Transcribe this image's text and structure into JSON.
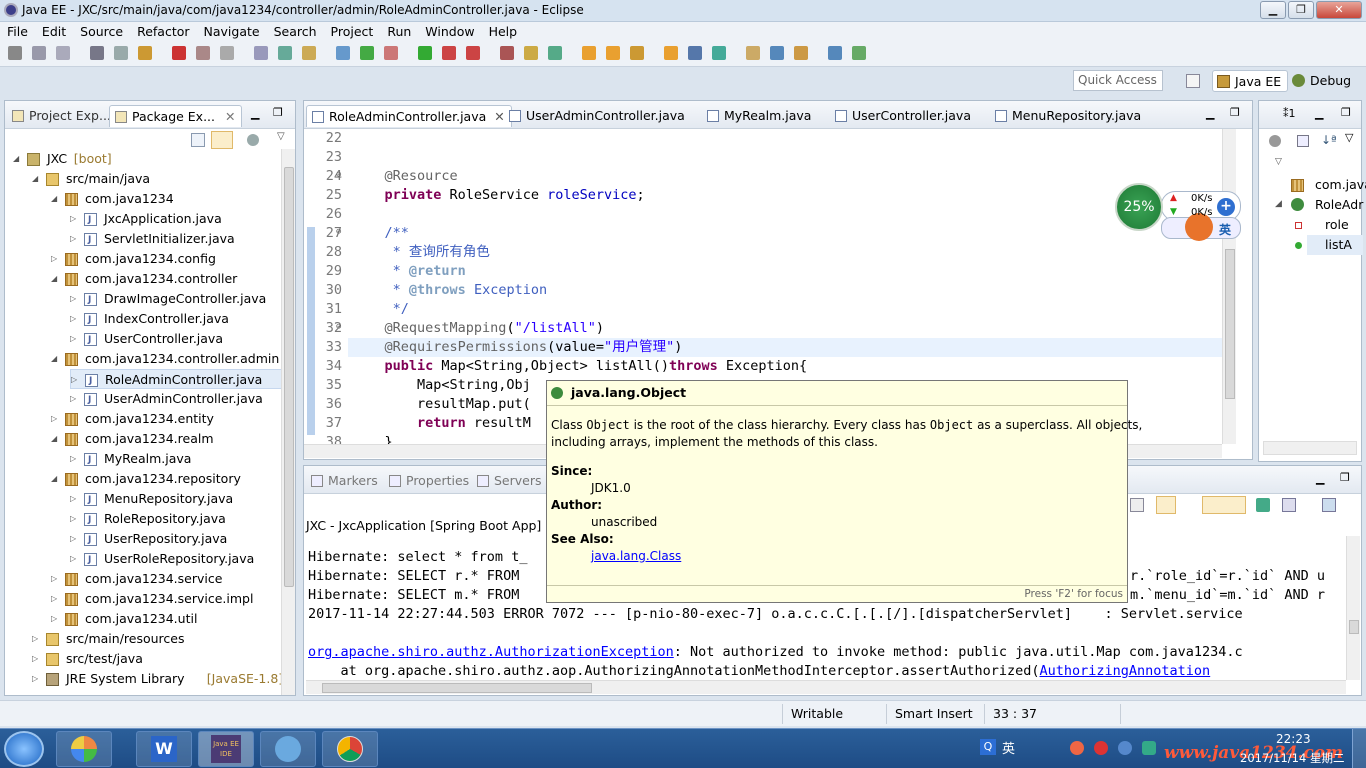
{
  "window": {
    "title": "Java EE - JXC/src/main/java/com/java1234/controller/admin/RoleAdminController.java - Eclipse"
  },
  "menu": [
    "File",
    "Edit",
    "Source",
    "Refactor",
    "Navigate",
    "Search",
    "Project",
    "Run",
    "Window",
    "Help"
  ],
  "quick_access": {
    "placeholder": "Quick Access"
  },
  "perspectives": [
    "Java EE",
    "Debug"
  ],
  "left_tabs": [
    "Project Exp...",
    "Package Ex..."
  ],
  "tree": [
    {
      "label": "JXC",
      "extra": "[boot]",
      "icon": "proj",
      "level": 0,
      "open": true
    },
    {
      "label": "src/main/java",
      "icon": "folder",
      "level": 1,
      "open": true
    },
    {
      "label": "com.java1234",
      "icon": "pkg",
      "level": 2,
      "open": true
    },
    {
      "label": "JxcApplication.java",
      "icon": "java",
      "level": 3,
      "open": false
    },
    {
      "label": "ServletInitializer.java",
      "icon": "java",
      "level": 3,
      "open": false
    },
    {
      "label": "com.java1234.config",
      "icon": "pkg",
      "level": 2,
      "open": false
    },
    {
      "label": "com.java1234.controller",
      "icon": "pkg",
      "level": 2,
      "open": true
    },
    {
      "label": "DrawImageController.java",
      "icon": "java",
      "level": 3,
      "open": false
    },
    {
      "label": "IndexController.java",
      "icon": "java",
      "level": 3,
      "open": false
    },
    {
      "label": "UserController.java",
      "icon": "java",
      "level": 3,
      "open": false
    },
    {
      "label": "com.java1234.controller.admin",
      "icon": "pkg",
      "level": 2,
      "open": true
    },
    {
      "label": "RoleAdminController.java",
      "icon": "java",
      "level": 3,
      "open": false,
      "selected": true
    },
    {
      "label": "UserAdminController.java",
      "icon": "java",
      "level": 3,
      "open": false
    },
    {
      "label": "com.java1234.entity",
      "icon": "pkg",
      "level": 2,
      "open": false
    },
    {
      "label": "com.java1234.realm",
      "icon": "pkg",
      "level": 2,
      "open": true
    },
    {
      "label": "MyRealm.java",
      "icon": "java",
      "level": 3,
      "open": false
    },
    {
      "label": "com.java1234.repository",
      "icon": "pkg",
      "level": 2,
      "open": true
    },
    {
      "label": "MenuRepository.java",
      "icon": "java",
      "level": 3,
      "open": false
    },
    {
      "label": "RoleRepository.java",
      "icon": "java",
      "level": 3,
      "open": false
    },
    {
      "label": "UserRepository.java",
      "icon": "java",
      "level": 3,
      "open": false
    },
    {
      "label": "UserRoleRepository.java",
      "icon": "java",
      "level": 3,
      "open": false
    },
    {
      "label": "com.java1234.service",
      "icon": "pkg",
      "level": 2,
      "open": false
    },
    {
      "label": "com.java1234.service.impl",
      "icon": "pkg",
      "level": 2,
      "open": false
    },
    {
      "label": "com.java1234.util",
      "icon": "pkg",
      "level": 2,
      "open": false
    },
    {
      "label": "src/main/resources",
      "icon": "folder",
      "level": 1,
      "open": false
    },
    {
      "label": "src/test/java",
      "icon": "folder",
      "level": 1,
      "open": false
    },
    {
      "label": "JRE System Library",
      "extra": "[JavaSE-1.8]",
      "icon": "lib",
      "level": 1,
      "open": false
    }
  ],
  "editor_tabs": [
    {
      "label": "RoleAdminController.java",
      "close": "✕"
    },
    {
      "label": "UserAdminController.java"
    },
    {
      "label": "MyRealm.java"
    },
    {
      "label": "UserController.java"
    },
    {
      "label": "MenuRepository.java"
    }
  ],
  "code": [
    {
      "n": "22",
      "t": [
        {
          "c": "",
          "s": ""
        }
      ]
    },
    {
      "n": "23",
      "t": [
        {
          "c": "",
          "s": ""
        }
      ]
    },
    {
      "n": "24",
      "t": [
        {
          "c": "an",
          "s": "    @Resource"
        }
      ]
    },
    {
      "n": "25",
      "t": [
        {
          "c": "kw",
          "s": "    private "
        },
        {
          "c": "",
          "s": "RoleService "
        },
        {
          "c": "fd",
          "s": "roleService"
        },
        {
          "c": "",
          "s": ";"
        }
      ]
    },
    {
      "n": "26",
      "t": [
        {
          "c": "",
          "s": ""
        }
      ]
    },
    {
      "n": "27",
      "t": [
        {
          "c": "cm",
          "s": "    /**"
        }
      ]
    },
    {
      "n": "28",
      "t": [
        {
          "c": "cm",
          "s": "     * 查询所有角色"
        }
      ]
    },
    {
      "n": "29",
      "t": [
        {
          "c": "cm",
          "s": "     * "
        },
        {
          "c": "tg",
          "s": "@return"
        }
      ]
    },
    {
      "n": "30",
      "t": [
        {
          "c": "cm",
          "s": "     * "
        },
        {
          "c": "tg",
          "s": "@throws"
        },
        {
          "c": "cm",
          "s": " Exception"
        }
      ]
    },
    {
      "n": "31",
      "t": [
        {
          "c": "cm",
          "s": "     */"
        }
      ]
    },
    {
      "n": "32",
      "t": [
        {
          "c": "an",
          "s": "    @RequestMapping"
        },
        {
          "c": "",
          "s": "("
        },
        {
          "c": "st",
          "s": "\"/listAll\""
        },
        {
          "c": "",
          "s": ")"
        }
      ]
    },
    {
      "n": "33",
      "t": [
        {
          "c": "an",
          "s": "    @RequiresPermissions"
        },
        {
          "c": "",
          "s": "(value="
        },
        {
          "c": "st",
          "s": "\"用户管理\""
        },
        {
          "c": "",
          "s": ")"
        }
      ]
    },
    {
      "n": "34",
      "t": [
        {
          "c": "kw",
          "s": "    public "
        },
        {
          "c": "",
          "s": "Map<String,Object> listAll()"
        },
        {
          "c": "kw",
          "s": "throws "
        },
        {
          "c": "",
          "s": "Exception{"
        }
      ]
    },
    {
      "n": "35",
      "t": [
        {
          "c": "",
          "s": "        Map<String,Obj"
        }
      ]
    },
    {
      "n": "36",
      "t": [
        {
          "c": "",
          "s": "        resultMap.put("
        }
      ]
    },
    {
      "n": "37",
      "t": [
        {
          "c": "kw",
          "s": "        return "
        },
        {
          "c": "",
          "s": "resultM"
        }
      ]
    },
    {
      "n": "38",
      "t": [
        {
          "c": "",
          "s": "    }"
        }
      ]
    }
  ],
  "outline": [
    "com.java",
    "RoleAdr",
    "role",
    "listA"
  ],
  "console_tabs": [
    "Markers",
    "Properties",
    "Servers"
  ],
  "console_header": "JXC - JxcApplication [Spring Boot App] E:",
  "console_lines": [
    {
      "parts": [
        {
          "c": "",
          "s": "Hibernate: select * from t_"
        }
      ]
    },
    {
      "parts": [
        {
          "c": "",
          "s": "Hibernate: SELECT r.* FROM "
        }
      ]
    },
    {
      "parts": [
        {
          "c": "",
          "s": "Hibernate: SELECT m.* FROM "
        }
      ]
    },
    {
      "parts": [
        {
          "c": "",
          "s": "2017-11-14 22:27:44.503 ERROR 7072 --- [p-nio-80-exec-7] o.a.c.c.C.[.[.[/].[dispatcherServlet]    : Servlet.service"
        }
      ]
    },
    {
      "parts": [
        {
          "c": "",
          "s": ""
        }
      ]
    },
    {
      "parts": [
        {
          "c": "link",
          "s": "org.apache.shiro.authz.AuthorizationException"
        },
        {
          "c": "",
          "s": ": Not authorized to invoke method: public java.util.Map com.java1234.c"
        }
      ]
    },
    {
      "parts": [
        {
          "c": "",
          "s": "    at org.apache.shiro.authz.aop.AuthorizingAnnotationMethodInterceptor.assertAuthorized("
        },
        {
          "c": "link",
          "s": "AuthorizingAnnotation"
        }
      ]
    }
  ],
  "console_right_fragments": [
    "r.`role_id`=r.`id` AND u",
    "m.`menu_id`=m.`id` AND r"
  ],
  "tooltip": {
    "title": "java.lang.Object",
    "desc1_a": "Class ",
    "desc1_code": "Object",
    "desc1_b": " is the root of the class hierarchy. Every class has ",
    "desc1_code2": "Object",
    "desc1_c": " as a superclass. All objects,",
    "desc2": "including arrays, implement the methods of this class.",
    "since_label": "Since:",
    "since_value": "JDK1.0",
    "author_label": "Author:",
    "author_value": "unascribed",
    "seealso_label": "See Also:",
    "seealso_value": "java.lang.Class",
    "footer": "Press 'F2' for focus"
  },
  "speed_widget": {
    "percent": "25%",
    "up": "0K/s",
    "down": "0K/s",
    "lang": "英"
  },
  "status": {
    "writable": "Writable",
    "insert": "Smart Insert",
    "position": "33 : 37"
  },
  "taskbar": {
    "time": "22:23",
    "date": "2017/11/14 星期二",
    "ime": "英",
    "watermark": "www.java1234.com",
    "app_label": "Java EE IDE"
  },
  "colors": {
    "keyword": "#7f0055",
    "string": "#2a00ff",
    "comment": "#3f5fbf",
    "annotation": "#646464",
    "tooltip_bg": "#ffffe1"
  }
}
